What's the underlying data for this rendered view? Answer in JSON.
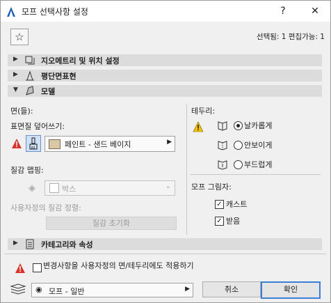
{
  "window": {
    "title": "모프 선택사항 설정",
    "help_label": "?",
    "close_label": "✕"
  },
  "toolbar": {
    "favorite_icon": "star-icon",
    "status_text": "선택됨: 1 편집가능: 1"
  },
  "sections": {
    "geometry": {
      "label": "지오메트리 및 위치 설정",
      "state": "collapsed"
    },
    "floor_plan": {
      "label": "평단면표현",
      "state": "collapsed"
    },
    "model": {
      "label": "모델",
      "state": "expanded"
    },
    "category": {
      "label": "카테고리와 속성",
      "state": "collapsed"
    }
  },
  "model_panel": {
    "faces_label": "면(들):",
    "override_label": "표면질 덮어쓰기:",
    "surface_value": "페인트 - 샌드 베이지",
    "surface_swatch_color": "#d8c8a6",
    "texture_mapping_label": "질감 맵핑:",
    "texture_value": "박스",
    "custom_align_label": "사용자정의 질감 정렬:",
    "reset_texture_label": "질감 초기화",
    "edges_label": "테두리:",
    "edge_options": [
      {
        "label": "날카롭게",
        "selected": true
      },
      {
        "label": "안보이게",
        "selected": false
      },
      {
        "label": "부드럽게",
        "selected": false
      }
    ],
    "shadow_label": "모프 그림자:",
    "shadow_options": [
      {
        "label": "캐스트",
        "checked": true
      },
      {
        "label": "받음",
        "checked": true
      }
    ]
  },
  "footer": {
    "apply_custom_label": "변경사항을 사용자정의 면/테두리에도 적용하기",
    "apply_custom_checked": false,
    "layer_value": "모프 - 일반",
    "cancel_label": "취소",
    "ok_label": "확인"
  },
  "colors": {
    "warning": "#f2c200",
    "warning_red": "#d9342b",
    "accent": "#3c7fd6"
  }
}
